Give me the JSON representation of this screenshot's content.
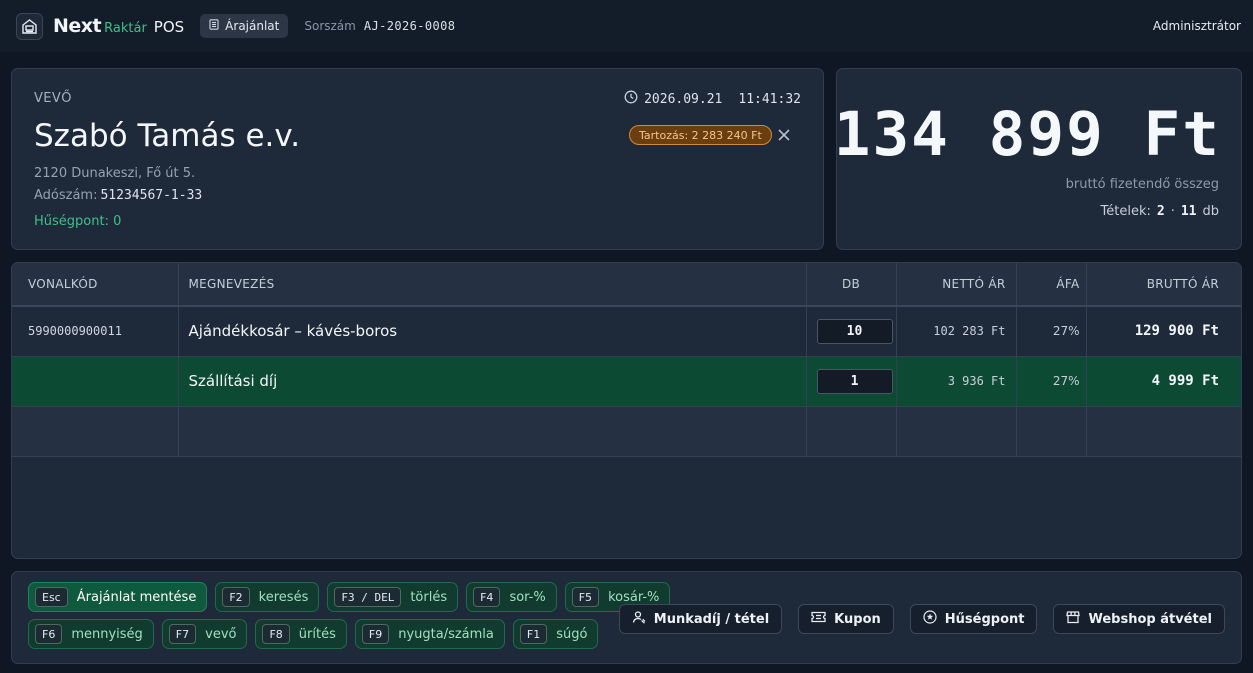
{
  "header": {
    "brand_name": "Next",
    "brand_sub": "Raktár",
    "brand_pos": "POS",
    "doc_type": "Árajánlat",
    "serial_label": "Sorszám",
    "serial_value": "AJ-2026-0008",
    "user": "Adminisztrátor"
  },
  "customer": {
    "section_label": "VEVŐ",
    "date": "2026.09.21",
    "time": "11:41:32",
    "name": "Szabó Tamás e.v.",
    "address": "2120 Dunakeszi, Fő út 5.",
    "tax_label": "Adószám:",
    "tax_number": "51234567-1-33",
    "loyalty": "Hűségpont: 0",
    "debt_badge": "Tartozás: 2 283 240 Ft"
  },
  "total": {
    "amount": "134 899 Ft",
    "caption": "bruttó fizetendő összeg",
    "items_label": "Tételek:",
    "items_count": "2",
    "items_sep": "·",
    "qty_count": "11",
    "qty_unit": "db"
  },
  "table": {
    "columns": [
      "VONALKÓD",
      "MEGNEVEZÉS",
      "DB",
      "NETTÓ ÁR",
      "ÁFA",
      "BRUTTÓ ÁR"
    ],
    "rows": [
      {
        "barcode": "5990000900011",
        "name": "Ajándékkosár – kávés-boros",
        "qty": "10",
        "net": "102 283 Ft",
        "vat": "27%",
        "gross": "129 900 Ft"
      },
      {
        "barcode": "",
        "name": "Szállítási díj",
        "qty": "1",
        "net": "3 936 Ft",
        "vat": "27%",
        "gross": "4 999 Ft"
      }
    ]
  },
  "shortcuts": {
    "row1": [
      {
        "key": "Esc",
        "label": "Árajánlat mentése"
      },
      {
        "key": "F2",
        "label": "keresés"
      },
      {
        "key": "F3 / DEL",
        "label": "törlés"
      },
      {
        "key": "F4",
        "label": "sor-%"
      },
      {
        "key": "F5",
        "label": "kosár-%"
      }
    ],
    "row2": [
      {
        "key": "F6",
        "label": "mennyiség"
      },
      {
        "key": "F7",
        "label": "vevő"
      },
      {
        "key": "F8",
        "label": "ürítés"
      },
      {
        "key": "F9",
        "label": "nyugta/számla"
      },
      {
        "key": "F1",
        "label": "súgó"
      }
    ]
  },
  "actions": {
    "labor": "Munkadíj / tétel",
    "coupon": "Kupon",
    "loyalty": "Hűségpont",
    "webshop": "Webshop átvétel"
  },
  "icons": {
    "logo": "register-icon",
    "doc": "document-icon",
    "clock": "clock-icon",
    "close": "close-icon",
    "labor": "worker-icon",
    "coupon": "ticket-icon",
    "loyalty": "star-icon",
    "webshop": "store-icon"
  },
  "colors": {
    "accent_green": "#3fc08a",
    "selected_row": "#0d4a34",
    "debt_badge": "#6b3e12"
  }
}
